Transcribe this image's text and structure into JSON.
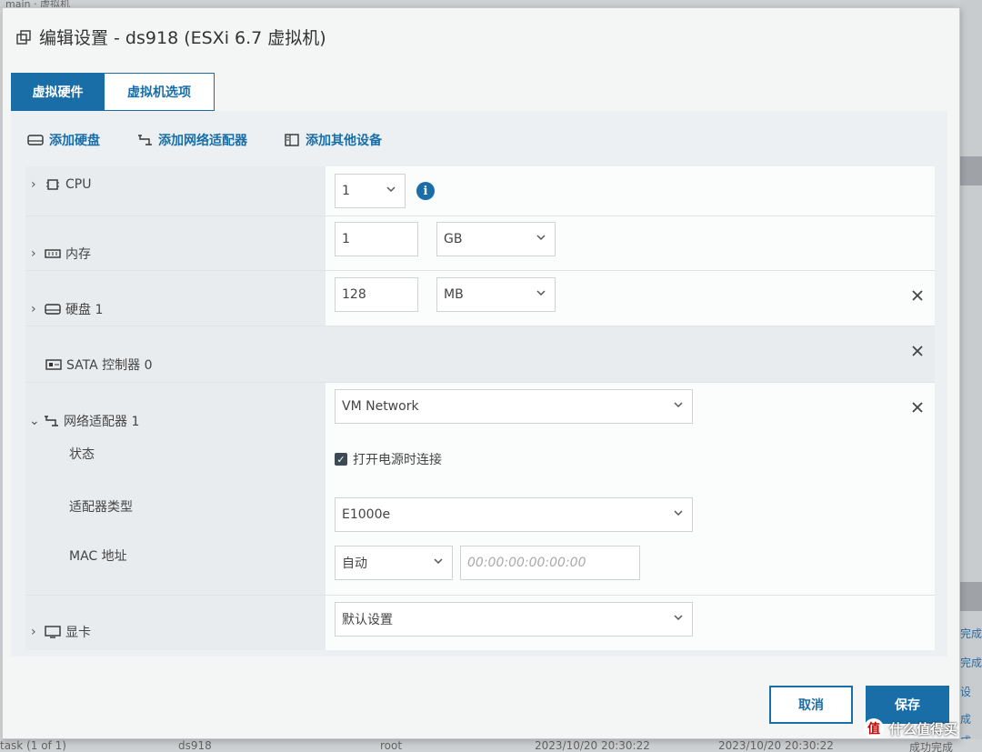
{
  "background": {
    "top_text": "main  · 虚拟机",
    "right_texts": [
      "完成",
      "完成",
      "设",
      "成",
      "成"
    ],
    "bottom_texts": [
      "task (1 of 1)",
      "ds918",
      "root",
      "2023/10/20 20:30:22",
      "2023/10/20 20:30:22",
      "成功完成"
    ]
  },
  "dialog": {
    "title": "编辑设置 - ds918 (ESXi 6.7 虚拟机)"
  },
  "tabs": [
    {
      "label": "虚拟硬件"
    },
    {
      "label": "虚拟机选项"
    }
  ],
  "toolbar": {
    "add_disk": "添加硬盘",
    "add_network": "添加网络适配器",
    "add_other": "添加其他设备"
  },
  "hardware": {
    "cpu": {
      "label": "CPU",
      "value": "1",
      "info": "i"
    },
    "memory": {
      "label": "内存",
      "value": "1",
      "unit": "GB"
    },
    "disk": {
      "label": "硬盘 1",
      "value": "128",
      "unit": "MB"
    },
    "sata": {
      "label": "SATA 控制器 0"
    },
    "network": {
      "label": "网络适配器 1",
      "value": "VM Network",
      "status_label": "状态",
      "connect_label": "打开电源时连接",
      "connect_checked": true,
      "adapter_type_label": "适配器类型",
      "adapter_type": "E1000e",
      "mac_label": "MAC 地址",
      "mac_mode": "自动",
      "mac_placeholder": "00:00:00:00:00:00"
    },
    "video": {
      "label": "显卡",
      "value": "默认设置"
    }
  },
  "buttons": {
    "cancel": "取消",
    "save": "保存"
  },
  "watermark": {
    "logo": "值",
    "text": "什么值得买"
  },
  "colors": {
    "accent": "#1a6ea7"
  }
}
